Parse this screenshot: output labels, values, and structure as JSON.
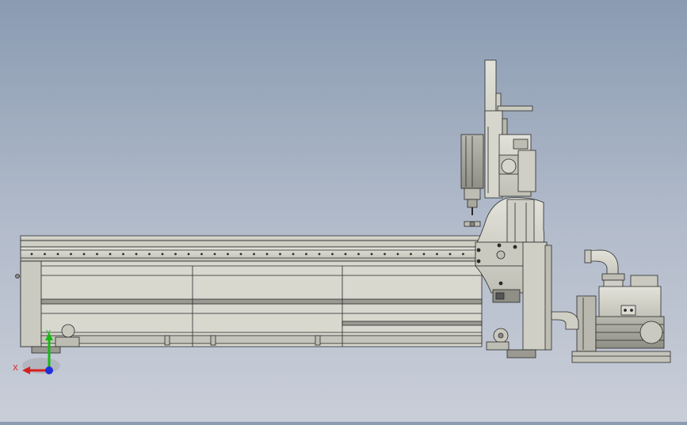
{
  "viewport": {
    "background_top": "#8a9bb2",
    "background_bottom": "#c9ced8",
    "part_color": "#d3d3c9",
    "edge_color": "#2a2a2a"
  },
  "triad": {
    "x_label": "X",
    "y_label": "Y",
    "x_color": "#d62020",
    "y_color": "#18b818",
    "z_color": "#2030d8"
  },
  "model": {
    "assembly": "cnc-router-side-view",
    "components": [
      "machine-bed",
      "gantry-frame",
      "z-axis-spindle",
      "vacuum-pump"
    ]
  }
}
